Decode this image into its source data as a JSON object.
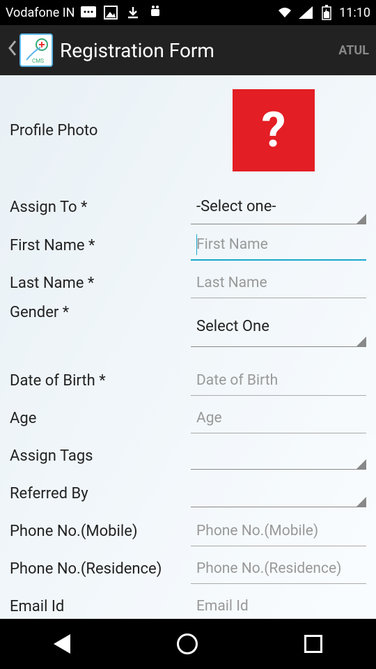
{
  "status": {
    "carrier": "Vodafone IN",
    "time": "11:10"
  },
  "header": {
    "title": "Registration Form",
    "user": "ATUL"
  },
  "form": {
    "photo": {
      "label": "Profile Photo"
    },
    "assignTo": {
      "label": "Assign To *",
      "value": "-Select one-"
    },
    "firstName": {
      "label": "First Name *",
      "placeholder": "First Name",
      "value": ""
    },
    "lastName": {
      "label": "Last Name *",
      "placeholder": "Last Name",
      "value": ""
    },
    "gender": {
      "label": "Gender *",
      "value": "Select One"
    },
    "dob": {
      "label": "Date of Birth *",
      "placeholder": "Date of Birth",
      "value": ""
    },
    "age": {
      "label": "Age",
      "placeholder": "Age",
      "value": ""
    },
    "assignTags": {
      "label": "Assign Tags",
      "value": ""
    },
    "referredBy": {
      "label": "Referred By",
      "value": ""
    },
    "phoneMobile": {
      "label": "Phone No.(Mobile)",
      "placeholder": "Phone No.(Mobile)",
      "value": ""
    },
    "phoneResidence": {
      "label": "Phone No.(Residence)",
      "placeholder": "Phone No.(Residence)",
      "value": ""
    },
    "email": {
      "label": "Email Id",
      "placeholder": "Email Id",
      "value": ""
    }
  }
}
